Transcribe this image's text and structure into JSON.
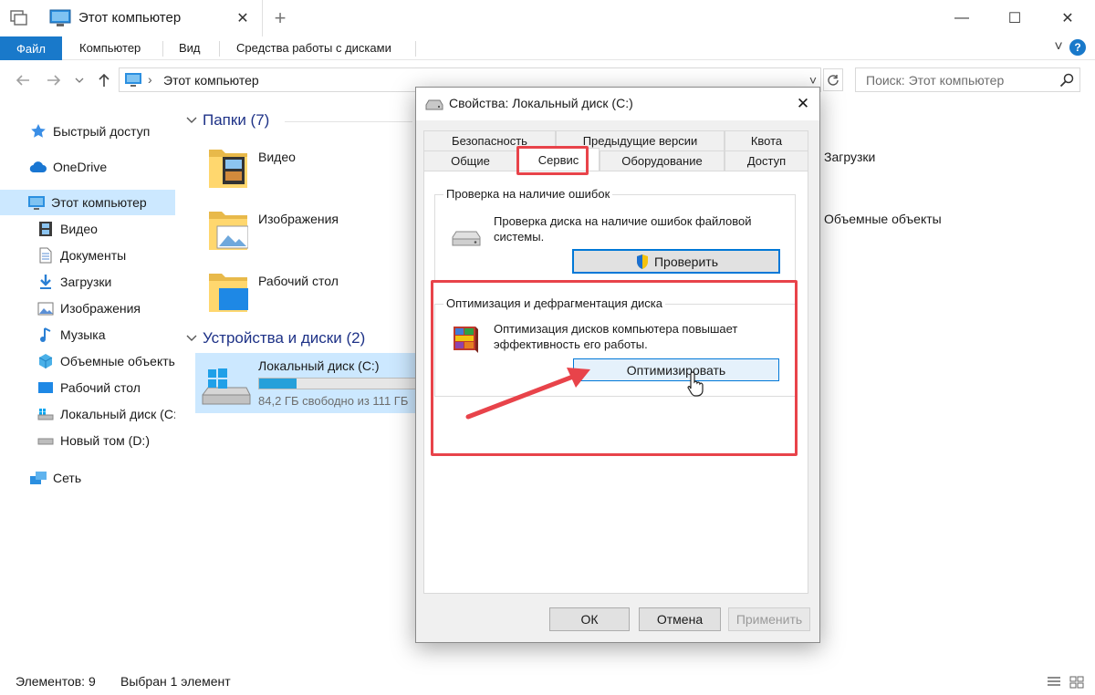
{
  "window": {
    "tab_title": "Этот компьютер",
    "new_tab_symbol": "+",
    "tab_close_symbol": "✕",
    "minimize_symbol": "—",
    "maximize_symbol": "☐",
    "close_symbol": "✕"
  },
  "ribbon": {
    "file": "Файл",
    "tabs": [
      "Компьютер",
      "Вид",
      "Средства работы с дисками"
    ],
    "expand_symbol": "˅",
    "help_symbol": "?"
  },
  "address": {
    "path": "Этот компьютер",
    "separator": "›",
    "dropdown_symbol": "˅",
    "search_placeholder": "Поиск: Этот компьютер"
  },
  "nav": {
    "quick_access": "Быстрый доступ",
    "onedrive": "OneDrive",
    "this_pc": "Этот компьютер",
    "children": [
      "Видео",
      "Документы",
      "Загрузки",
      "Изображения",
      "Музыка",
      "Объемные объекты",
      "Рабочий стол",
      "Локальный диск (C:)",
      "Новый том (D:)"
    ],
    "network": "Сеть"
  },
  "content": {
    "folders_header": "Папки (7)",
    "folders": [
      "Видео",
      "Изображения",
      "Рабочий стол",
      "Загрузки",
      "Объемные объекты"
    ],
    "devices_header": "Устройства и диски (2)",
    "drive": {
      "name": "Локальный диск (C:)",
      "free": "84,2 ГБ свободно из 111 ГБ",
      "used_fraction": 0.24
    }
  },
  "status": {
    "count": "Элементов: 9",
    "selected": "Выбран 1 элемент"
  },
  "dialog": {
    "title": "Свойства: Локальный диск (C:)",
    "close_symbol": "✕",
    "tabs_top": [
      "Безопасность",
      "Предыдущие версии",
      "Квота"
    ],
    "tabs_bottom": [
      "Общие",
      "Сервис",
      "Оборудование",
      "Доступ"
    ],
    "check": {
      "title": "Проверка на наличие ошибок",
      "text": "Проверка диска на наличие ошибок файловой системы.",
      "button": "Проверить"
    },
    "optimize": {
      "title": "Оптимизация и дефрагментация диска",
      "text": "Оптимизация дисков компьютера повышает эффективность его работы.",
      "button": "Оптимизировать"
    },
    "ok": "ОК",
    "cancel": "Отмена",
    "apply": "Применить"
  },
  "colors": {
    "accent": "#1979ca",
    "annotation": "#e8434a",
    "selection": "#cce8ff",
    "group_header": "#1e3287"
  }
}
